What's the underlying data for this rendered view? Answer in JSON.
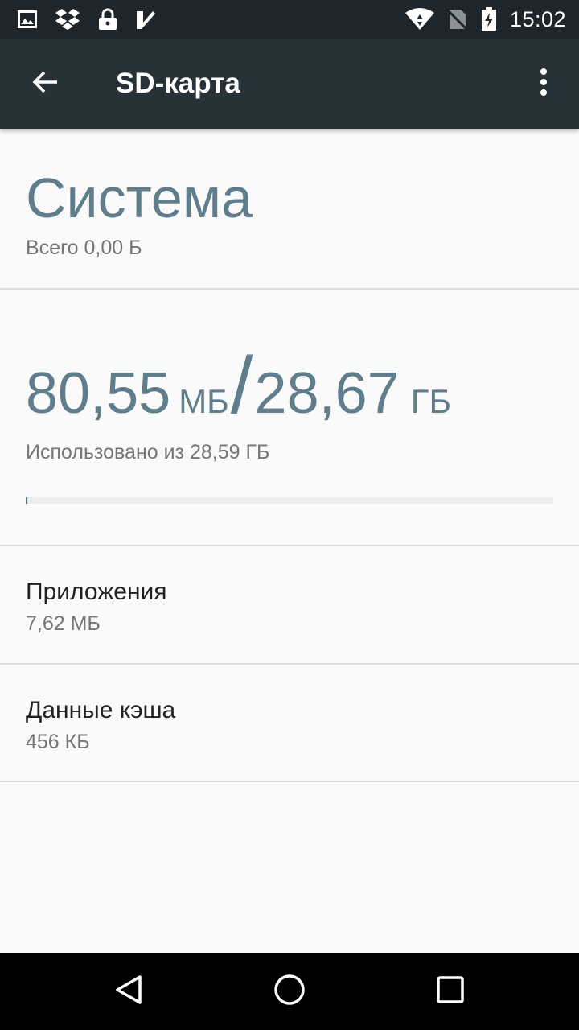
{
  "status_bar": {
    "time": "15:02",
    "left_icons": [
      "image-icon",
      "dropbox-icon",
      "lock-icon",
      "check-app-icon"
    ],
    "right_icons": [
      "wifi-icon",
      "no-sim-icon",
      "battery-charging-icon"
    ]
  },
  "app_bar": {
    "title": "SD-карта",
    "back_icon": "arrow-back-icon",
    "menu_icon": "more-vert-icon"
  },
  "system": {
    "title": "Система",
    "total": "Всего 0,00 Б"
  },
  "usage": {
    "used_value": "80,55",
    "used_unit": "МБ",
    "total_value": "28,67",
    "total_unit": "ГБ",
    "description": "Использовано из 28,59 ГБ",
    "progress_fraction": 0.003
  },
  "items": [
    {
      "title": "Приложения",
      "value": "7,62 МБ"
    },
    {
      "title": "Данные кэша",
      "value": "456 КБ"
    }
  ],
  "colors": {
    "accent": "#607d8b",
    "app_bar": "#263238",
    "status_bar": "#1f262b"
  }
}
